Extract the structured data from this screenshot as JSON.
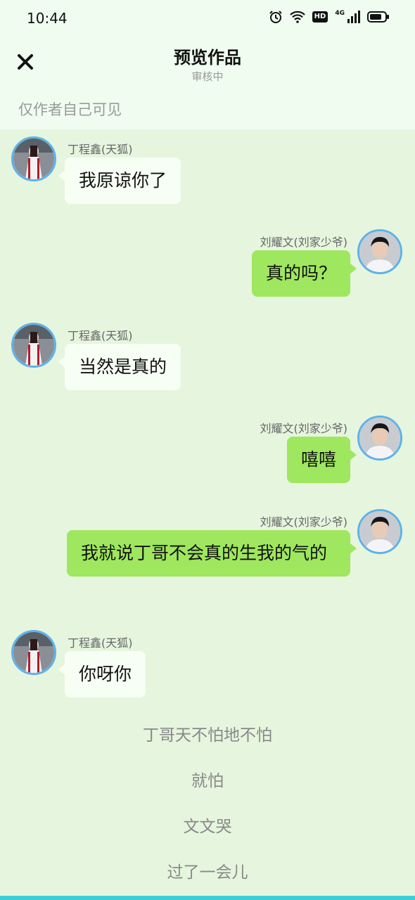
{
  "status_bar": {
    "time": "10:44",
    "network": "4G",
    "hd": "HD"
  },
  "header": {
    "title": "预览作品",
    "subtitle": "审核中"
  },
  "visibility_note": "仅作者自己可见",
  "messages": [
    {
      "side": "left",
      "name": "丁程鑫(天狐)",
      "text": "我原谅你了"
    },
    {
      "side": "right",
      "name": "刘耀文(刘家少爷)",
      "text": "真的吗？"
    },
    {
      "side": "left",
      "name": "丁程鑫(天狐)",
      "text": "当然是真的"
    },
    {
      "side": "right",
      "name": "刘耀文(刘家少爷)",
      "text": "嘻嘻"
    },
    {
      "side": "right",
      "name": "刘耀文(刘家少爷)",
      "text": "我就说丁哥不会真的生我的气的"
    },
    {
      "side": "left",
      "name": "丁程鑫(天狐)",
      "text": "你呀你"
    }
  ],
  "narrations": [
    "丁哥天不怕地不怕",
    "就怕",
    "文文哭",
    "过了一会儿"
  ],
  "colors": {
    "header_bg": "#f0fcf0",
    "chat_bg": "#e6f5de",
    "left_bubble": "#f7fff4",
    "right_bubble": "#9fe75e",
    "avatar_border": "#5fb2e8",
    "accent_bar": "#3ccfd8"
  }
}
